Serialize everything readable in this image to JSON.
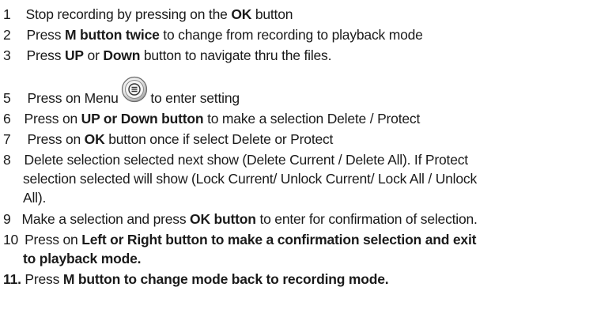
{
  "steps": [
    {
      "num": "1",
      "parts": [
        "Stop recording by pressing on the ",
        "OK",
        " button"
      ]
    },
    {
      "num": "2",
      "parts": [
        "Press ",
        "M button twice",
        " to change from recording to playback mode"
      ]
    },
    {
      "num": "3",
      "parts": [
        "Press ",
        "UP",
        " or ",
        "Down",
        " button to navigate thru the files."
      ]
    },
    {
      "num": "5",
      "parts": [
        "Press on Menu ",
        "to enter setting"
      ]
    },
    {
      "num": "6",
      "parts": [
        "Press on ",
        "UP or Down button",
        " to make a selection Delete / Protect"
      ]
    },
    {
      "num": "7",
      "parts": [
        "Press on ",
        "OK",
        " button once if select Delete or Protect"
      ]
    },
    {
      "num": "8",
      "lines": [
        "Delete selection selected next show (Delete Current / Delete All). If Protect",
        "selection selected will show (Lock Current/ Unlock Current/ Lock All / Unlock",
        "All)."
      ]
    },
    {
      "num": "9",
      "parts": [
        "Make a selection and press ",
        "OK button",
        " to enter for confirmation of selection."
      ]
    },
    {
      "num": "10",
      "lines": [
        "Press on Left or Right button to make a confirmation selection and exit",
        "to playback mode."
      ],
      "prefix": "Press on "
    },
    {
      "num": "11.",
      "parts": [
        " Press ",
        "M button to change mode back to recording mode."
      ]
    }
  ],
  "menu_icon": "menu-button-icon"
}
